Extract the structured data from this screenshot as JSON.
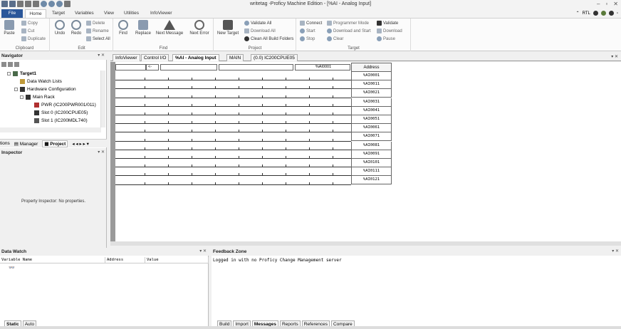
{
  "window": {
    "title": "writetag -Proficy Machine Edition - [%AI - Analog Input]",
    "controls": [
      "–",
      "▫",
      "✕"
    ]
  },
  "ribbon_tabs": [
    "File",
    "Home",
    "Target",
    "Variables",
    "View",
    "Utilities",
    "InfoViewer"
  ],
  "ribbon_right": {
    "rtl": "RTL"
  },
  "ribbon": {
    "clipboard": {
      "label": "Clipboard",
      "paste": "Paste",
      "copy": "Copy",
      "cut": "Cut",
      "duplicate": "Duplicate"
    },
    "edit": {
      "label": "Edit",
      "undo": "Undo",
      "redo": "Redo",
      "delete": "Delete",
      "rename": "Rename",
      "select_all": "Select All"
    },
    "find": {
      "label": "Find",
      "find": "Find",
      "replace": "Replace",
      "next_message": "Next Message",
      "next_error": "Next Error"
    },
    "project": {
      "label": "Project",
      "new_target": "New Target",
      "validate_all": "Validate All",
      "download_all": "Download All",
      "clean_all": "Clean All Build Folders"
    },
    "target": {
      "label": "Target",
      "connect": "Connect",
      "start": "Start",
      "stop": "Stop",
      "programmer_mode": "Programmer Mode",
      "download_and_start": "Download and Start",
      "clear": "Clear",
      "validate": "Validate",
      "download": "Download",
      "pause": "Pause"
    }
  },
  "navigator": {
    "title": "Navigator",
    "tree": [
      {
        "label": "Target1",
        "level": 1
      },
      {
        "label": "Data Watch Lists",
        "level": 2
      },
      {
        "label": "Hardware Configuration",
        "level": 2
      },
      {
        "label": "Main Rack",
        "level": 3
      },
      {
        "label": "PWR (IC200PWR001/011)",
        "level": 4
      },
      {
        "label": "Slot 0 (IC200CPUE05)",
        "level": 4
      },
      {
        "label": "Slot 1 (IC200MDL740)",
        "level": 4
      }
    ],
    "tabs": [
      "tions",
      "Manager",
      "Project"
    ]
  },
  "inspector": {
    "title": "Inspector",
    "message": "Property Inspector: No properties."
  },
  "doc_tabs": [
    "InfoViewer",
    "Control I/O",
    "%AI - Analog Input",
    "MAIN",
    "(0.0) IC200CPUE05"
  ],
  "grid": {
    "header_left": "<-",
    "header_addr_value": "%AI0001",
    "address_header": "Address",
    "addresses": [
      "%AI0001",
      "%AI0011",
      "%AI0021",
      "%AI0031",
      "%AI0041",
      "%AI0051",
      "%AI0061",
      "%AI0071",
      "%AI0081",
      "%AI0091",
      "%AI0101",
      "%AI0111",
      "%AI0121"
    ]
  },
  "datawatch": {
    "title": "Data Watch",
    "columns": [
      "Variable Name",
      "Address",
      "Value"
    ],
    "tabs": [
      "Static",
      "Auto"
    ]
  },
  "feedback": {
    "title": "Feedback Zone",
    "message": "Logged in with no Proficy Change Management server",
    "tabs": [
      "Build",
      "Import",
      "Messages",
      "Reports",
      "References",
      "Compare"
    ]
  },
  "colors": {
    "file_tab": "#2b579a",
    "ribbon_bg": "#fbfbfb",
    "gutter": "#9a9a9a"
  }
}
